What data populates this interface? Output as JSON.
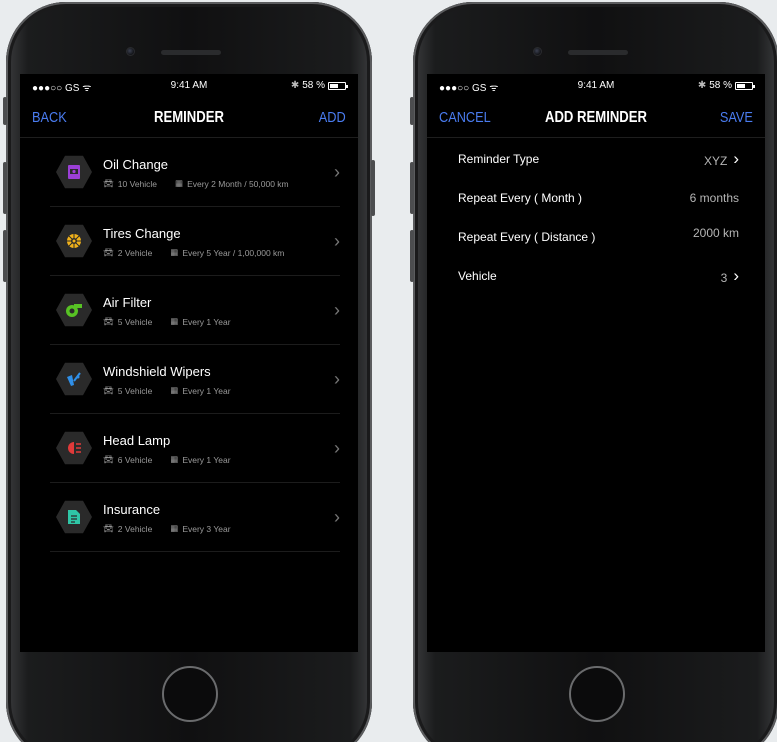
{
  "left_screen": {
    "status": {
      "carrier": "●●●○○ GS ",
      "time": "9:41 AM",
      "battery": "58 %",
      "battery_level": 0.58
    },
    "nav": {
      "back": "BACK",
      "title": "REMINDER",
      "add": "ADD"
    },
    "items": [
      {
        "title": "Oil Change",
        "vehicles": "10 Vehicle",
        "schedule": "Every 2 Month / 50,000 km",
        "icon": "oil-icon",
        "color": "#9b3fd6"
      },
      {
        "title": "Tires Change",
        "vehicles": "2 Vehicle",
        "schedule": "Every 5 Year / 1,00,000 km",
        "icon": "tire-icon",
        "color": "#f2b21a"
      },
      {
        "title": "Air Filter",
        "vehicles": "5 Vehicle",
        "schedule": "Every 1 Year",
        "icon": "air-filter-icon",
        "color": "#57c224"
      },
      {
        "title": "Windshield Wipers",
        "vehicles": "5 Vehicle",
        "schedule": "Every 1 Year",
        "icon": "wiper-icon",
        "color": "#2f8fe8"
      },
      {
        "title": "Head Lamp",
        "vehicles": "6 Vehicle",
        "schedule": "Every 1 Year",
        "icon": "head-lamp-icon",
        "color": "#e03a3a"
      },
      {
        "title": "Insurance",
        "vehicles": "2 Vehicle",
        "schedule": "Every 3 Year",
        "icon": "insurance-icon",
        "color": "#2fc6a6"
      }
    ]
  },
  "right_screen": {
    "status": {
      "carrier": "●●●○○ GS ",
      "time": "9:41 AM",
      "battery": "58 %",
      "battery_level": 0.58
    },
    "nav": {
      "cancel": "CANCEL",
      "title": "ADD REMINDER",
      "save": "SAVE"
    },
    "rows": [
      {
        "label": "Reminder Type",
        "value": "XYZ",
        "chevron": true
      },
      {
        "label": "Repeat Every ( Month )",
        "value": "6 months",
        "chevron": false
      },
      {
        "label": "Repeat Every ( Distance )",
        "value": "2000 km",
        "chevron": false
      },
      {
        "label": "Vehicle",
        "value": "3",
        "chevron": true
      }
    ]
  },
  "theme": {
    "accent": "#4a7cf0",
    "background": "#000000",
    "hex_bg": "#2a2a2a"
  }
}
